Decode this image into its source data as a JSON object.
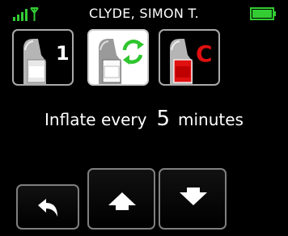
{
  "status_bar": {
    "patient_name": "CLYDE, SIMON T.",
    "signal_icon": "signal-strength-icon",
    "battery_icon": "battery-icon",
    "accent_color": "#33cc33"
  },
  "modes": [
    {
      "label": "1",
      "icon": "cuff-single-icon",
      "selected": false
    },
    {
      "label": "",
      "icon": "cuff-cycle-icon",
      "selected": true
    },
    {
      "label": "C",
      "icon": "cuff-continuous-icon",
      "selected": false
    }
  ],
  "inflate": {
    "label": "Inflate every",
    "value": "5",
    "unit": "minutes"
  },
  "nav": {
    "back_icon": "back-arrow-icon",
    "up_icon": "up-arrow-icon",
    "down_icon": "down-arrow-icon"
  },
  "colors": {
    "cycle_green": "#2ec52e",
    "continuous_red": "#e01010"
  }
}
